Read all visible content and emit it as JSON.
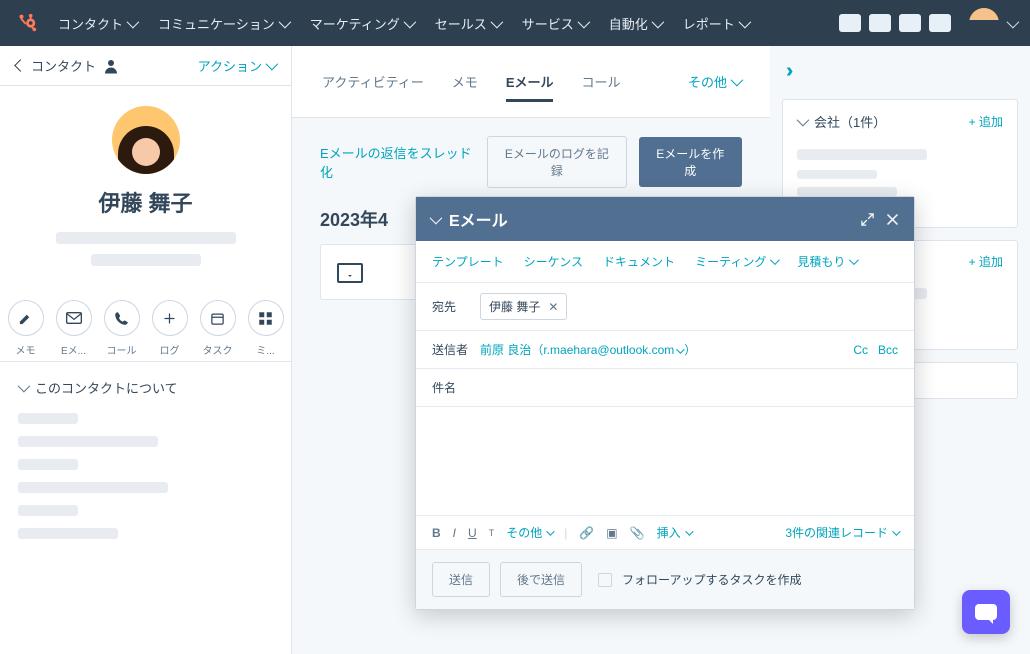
{
  "nav": {
    "items": [
      "コンタクト",
      "コミュニケーション",
      "マーケティング",
      "セールス",
      "サービス",
      "自動化",
      "レポート"
    ]
  },
  "left": {
    "back_label": "コンタクト",
    "actions": "アクション",
    "contact_name": "伊藤 舞子",
    "icons": [
      {
        "name": "note-icon",
        "lbl": "メモ"
      },
      {
        "name": "email-icon",
        "lbl": "Eメ..."
      },
      {
        "name": "call-icon",
        "lbl": "コール"
      },
      {
        "name": "plus-icon",
        "lbl": "ログ"
      },
      {
        "name": "task-icon",
        "lbl": "タスク"
      },
      {
        "name": "more-icon",
        "lbl": "ミ..."
      }
    ],
    "about": "このコンタクトについて"
  },
  "center": {
    "tabs": {
      "activity": "アクティビティー",
      "memo": "メモ",
      "email": "Eメール",
      "call": "コール",
      "other": "その他"
    },
    "toolbar": {
      "thread": "Eメールの返信をスレッド化",
      "log": "Eメールのログを記録",
      "create": "Eメールを作成"
    },
    "date": "2023年4"
  },
  "right": {
    "company": {
      "title": "会社（1件）",
      "add": "+ 追加"
    },
    "card2": {
      "add": "+ 追加"
    }
  },
  "compose": {
    "title": "Eメール",
    "tabs": {
      "template": "テンプレート",
      "sequence": "シーケンス",
      "document": "ドキュメント",
      "meeting": "ミーティング",
      "quote": "見積もり"
    },
    "to_label": "宛先",
    "to_chip": "伊藤 舞子",
    "from_label": "送信者",
    "from_name": "前原 良治",
    "from_email": "（r.maehara@outlook.com",
    "cc": "Cc",
    "bcc": "Bcc",
    "subject_label": "件名",
    "fmt": {
      "other": "その他",
      "insert": "挿入",
      "related": "3件の関連レコード"
    },
    "footer": {
      "send": "送信",
      "later": "後で送信",
      "followup": "フォローアップするタスクを作成"
    }
  }
}
